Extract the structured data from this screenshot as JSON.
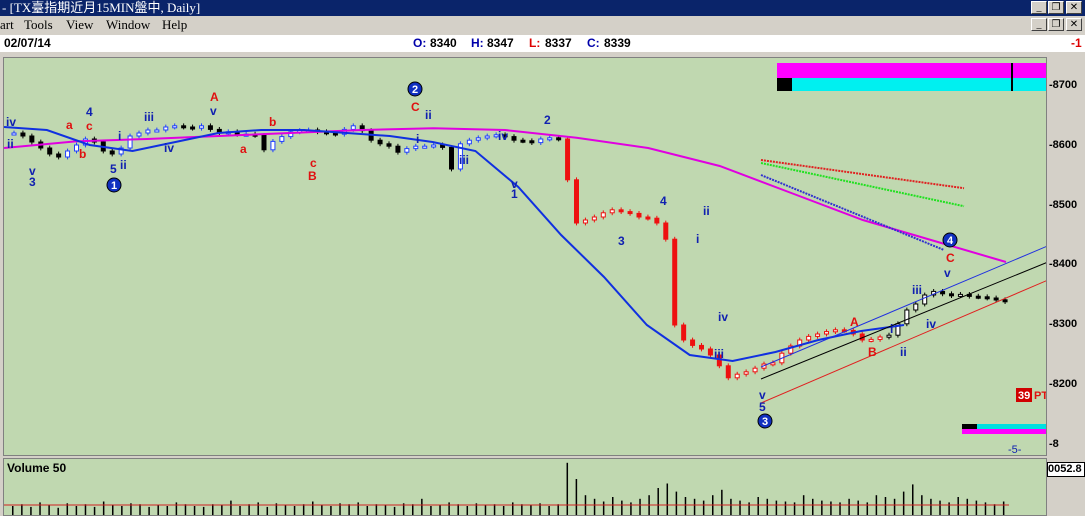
{
  "window": {
    "title": "- [TX臺指期近月15MIN盤中, Daily]",
    "minimize": "_",
    "restore": "❐",
    "close": "✕"
  },
  "menu": [
    "art",
    "Tools",
    "View",
    "Window",
    "Help"
  ],
  "info": {
    "date": "02/07/14",
    "open_label": "O:",
    "open": "8340",
    "high_label": "H:",
    "high": "8347",
    "low_label": "L:",
    "low": "8337",
    "close_label": "C:",
    "close": "8339",
    "right_flag": "-1"
  },
  "volume": {
    "label": "Volume 50",
    "readout": "0052.8"
  },
  "side": {
    "pt_value": "39",
    "pt_label": "PT",
    "bottom_value": "-5-"
  },
  "colors": {
    "background": "#c0d8b0",
    "ma_magenta": "#e000e0",
    "ma_blue": "#1030e0",
    "up_bar": "#2040ff",
    "down_bar": "#ee1010",
    "wave_blue": "#1020b0",
    "wave_red": "#e01010"
  },
  "chart_data": {
    "type": "candlestick",
    "title": "TX臺指期近月15MIN盤中, Daily",
    "ylim": [
      8130,
      8730
    ],
    "yticks": [
      "8700",
      "8600",
      "8500",
      "8400",
      "8300",
      "8200",
      "8"
    ],
    "series": [
      {
        "name": "price",
        "values": [
          8620,
          8615,
          8605,
          8595,
          8585,
          8580,
          8590,
          8600,
          8610,
          8605,
          8590,
          8585,
          8595,
          8615,
          8620,
          8625,
          8625,
          8630,
          8632,
          8630,
          8628,
          8632,
          8626,
          8620,
          8622,
          8618,
          8618,
          8616,
          8592,
          8606,
          8614,
          8622,
          8624,
          8625,
          8622,
          8620,
          8618,
          8626,
          8632,
          8624,
          8608,
          8602,
          8598,
          8588,
          8594,
          8598,
          8598,
          8600,
          8596,
          8560,
          8602,
          8608,
          8612,
          8615,
          8617,
          8614,
          8608,
          8607,
          8604,
          8610,
          8612,
          8610,
          8542,
          8470,
          8475,
          8480,
          8487,
          8492,
          8489,
          8486,
          8480,
          8478,
          8470,
          8443,
          8300,
          8275,
          8266,
          8260,
          8250,
          8232,
          8212,
          8218,
          8222,
          8228,
          8235,
          8237,
          8253,
          8265,
          8275,
          8281,
          8285,
          8289,
          8292,
          8291,
          8285,
          8275,
          8276,
          8280,
          8283,
          8302,
          8325,
          8335,
          8350,
          8356,
          8352,
          8349,
          8351,
          8348,
          8347,
          8345,
          8342,
          8339
        ]
      },
      {
        "name": "MA magenta",
        "values": [
          8595,
          8606,
          8610,
          8615,
          8620,
          8625,
          8628,
          8625,
          8612,
          8595,
          8565,
          8520,
          8475,
          8440,
          8405
        ]
      },
      {
        "name": "MA blue",
        "values": [
          8630,
          8625,
          8600,
          8590,
          8605,
          8620,
          8625,
          8625,
          8620,
          8615,
          8605,
          8590,
          8530,
          8450,
          8380,
          8300,
          8250,
          8240,
          8255,
          8275,
          8290,
          8300
        ]
      }
    ],
    "wave_labels": [
      {
        "text": "iv"
      },
      {
        "text": "ii"
      },
      {
        "text": "v"
      },
      {
        "text": "3"
      },
      {
        "text": "a"
      },
      {
        "text": "4"
      },
      {
        "text": "c"
      },
      {
        "text": "b"
      },
      {
        "text": "i"
      },
      {
        "text": "ii"
      },
      {
        "text": "5"
      },
      {
        "text": "1"
      },
      {
        "text": "iii"
      },
      {
        "text": "iv"
      },
      {
        "text": "A"
      },
      {
        "text": "v"
      },
      {
        "text": "b"
      },
      {
        "text": "a"
      },
      {
        "text": "c"
      },
      {
        "text": "B"
      },
      {
        "text": "2"
      },
      {
        "text": "C"
      },
      {
        "text": "ii"
      },
      {
        "text": "i"
      },
      {
        "text": "iii"
      },
      {
        "text": "iv"
      },
      {
        "text": "v"
      },
      {
        "text": "1"
      },
      {
        "text": "2"
      },
      {
        "text": "3"
      },
      {
        "text": "4"
      },
      {
        "text": "ii"
      },
      {
        "text": "i"
      },
      {
        "text": "iv"
      },
      {
        "text": "iii"
      },
      {
        "text": "v"
      },
      {
        "text": "5"
      },
      {
        "text": "3"
      },
      {
        "text": "A"
      },
      {
        "text": "B"
      },
      {
        "text": "i"
      },
      {
        "text": "ii"
      },
      {
        "text": "iii"
      },
      {
        "text": "iv"
      },
      {
        "text": "v"
      },
      {
        "text": "4"
      },
      {
        "text": "C"
      }
    ],
    "volume_values": [
      10,
      12,
      9,
      14,
      11,
      8,
      13,
      10,
      12,
      9,
      15,
      11,
      10,
      13,
      12,
      9,
      11,
      10,
      14,
      12,
      10,
      9,
      12,
      11,
      16,
      10,
      12,
      14,
      9,
      13,
      11,
      10,
      12,
      15,
      11,
      10,
      13,
      12,
      14,
      10,
      12,
      11,
      9,
      13,
      12,
      18,
      10,
      11,
      14,
      12,
      10,
      13,
      11,
      12,
      10,
      14,
      12,
      11,
      13,
      10,
      12,
      58,
      40,
      22,
      18,
      15,
      20,
      16,
      14,
      18,
      22,
      30,
      35,
      26,
      20,
      18,
      16,
      22,
      28,
      18,
      16,
      14,
      20,
      18,
      16,
      15,
      14,
      22,
      18,
      16,
      15,
      14,
      18,
      16,
      14,
      22,
      20,
      18,
      26,
      34,
      22,
      18,
      16,
      14,
      20,
      18,
      16,
      14,
      12,
      15
    ]
  }
}
